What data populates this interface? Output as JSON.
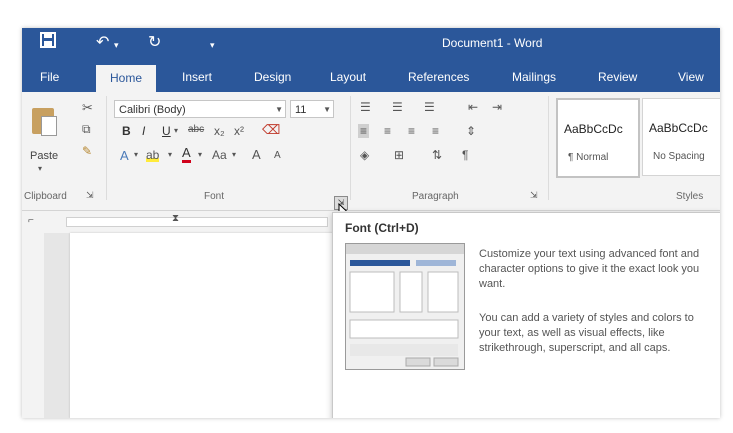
{
  "app": {
    "title": "Document1 - Word",
    "accent": "#2b579a"
  },
  "qat": {
    "save_icon": "save-icon",
    "undo_icon": "undo-icon",
    "redo_icon": "redo-icon",
    "customize_icon": "customize-qat-icon"
  },
  "tabs": [
    "File",
    "Home",
    "Insert",
    "Design",
    "Layout",
    "References",
    "Mailings",
    "Review",
    "View"
  ],
  "ribbon": {
    "clipboard": {
      "paste_label": "Paste",
      "group_label": "Clipboard"
    },
    "font": {
      "font_name": "Calibri (Body)",
      "font_size": "11",
      "bold": "B",
      "italic": "I",
      "underline": "U",
      "strikethrough": "abc",
      "subscript": "x₂",
      "superscript": "x²",
      "change_case": "Aa",
      "grow": "A",
      "shrink": "A",
      "group_label": "Font"
    },
    "paragraph": {
      "group_label": "Paragraph",
      "pilcrow": "¶"
    },
    "styles": {
      "items": [
        {
          "sample": "AaBbCcDc",
          "name": "¶ Normal"
        },
        {
          "sample": "AaBbCcDc",
          "name": "No Spacing"
        }
      ],
      "group_label": "Styles"
    }
  },
  "tooltip": {
    "title": "Font (Ctrl+D)",
    "para1": "Customize your text using advanced font and character options to give it the exact look you want.",
    "para2": "You can add a variety of styles and colors to your text, as well as visual effects, like strikethrough, superscript, and all caps."
  }
}
